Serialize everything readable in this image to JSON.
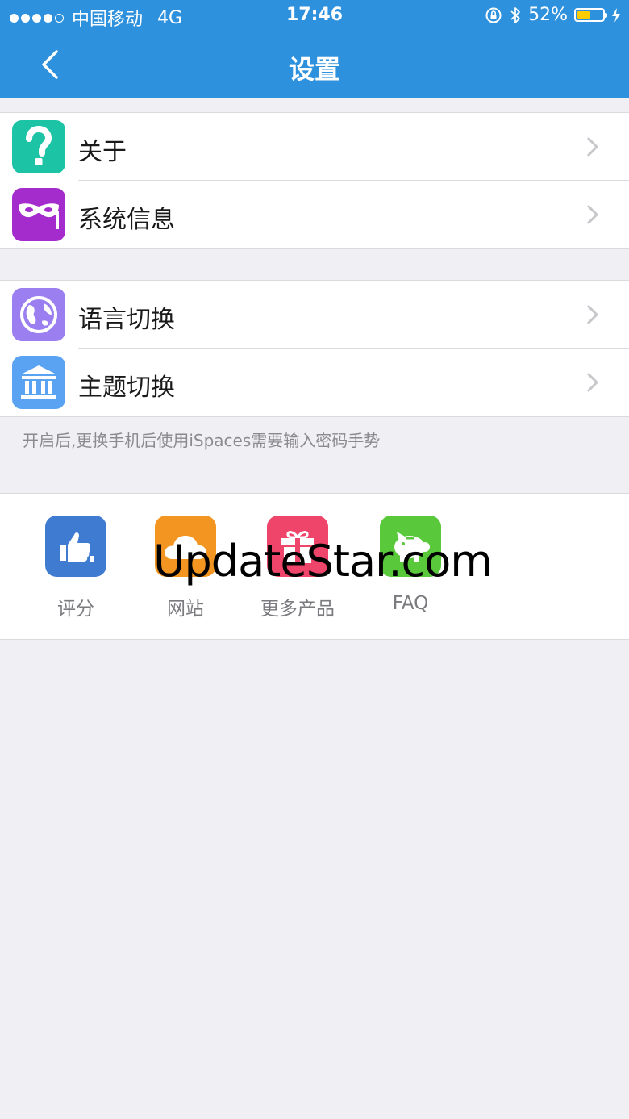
{
  "status_bar": {
    "carrier": "中国移动",
    "network": "4G",
    "time": "17:46",
    "battery": "52%",
    "battery_level": 0.52,
    "icons": [
      "signal-dots",
      "orientation-lock-icon",
      "bluetooth-icon",
      "battery-icon",
      "charging-icon"
    ]
  },
  "nav": {
    "title": "设置",
    "back_icon": "chevron-left-icon"
  },
  "settings_group_1": [
    {
      "label": "关于",
      "icon": "question-icon",
      "color": "#1cc3a5"
    },
    {
      "label": "系统信息",
      "icon": "mask-icon",
      "color": "#a42ccd"
    }
  ],
  "settings_group_2": [
    {
      "label": "语言切换",
      "icon": "globe-icon",
      "color": "#9b7ff0"
    },
    {
      "label": "主题切换",
      "icon": "museum-icon",
      "color": "#5aa3f2"
    }
  ],
  "note": "开启后,更换手机后使用iSpaces需要输入密码手势",
  "apps": [
    {
      "label": "评分",
      "icon": "thumbs-up-icon",
      "color": "#3f7cd1"
    },
    {
      "label": "网站",
      "icon": "cloud-icon",
      "color": "#f39621"
    },
    {
      "label": "更多产品",
      "icon": "gift-icon",
      "color": "#f0456a"
    },
    {
      "label": "FAQ",
      "icon": "piggy-bank-icon",
      "color": "#59c93b"
    }
  ],
  "watermark": "UpdateStar.com",
  "colors": {
    "header": "#2d91dd",
    "background": "#efeff4",
    "battery_fill": "#ffcc00"
  }
}
